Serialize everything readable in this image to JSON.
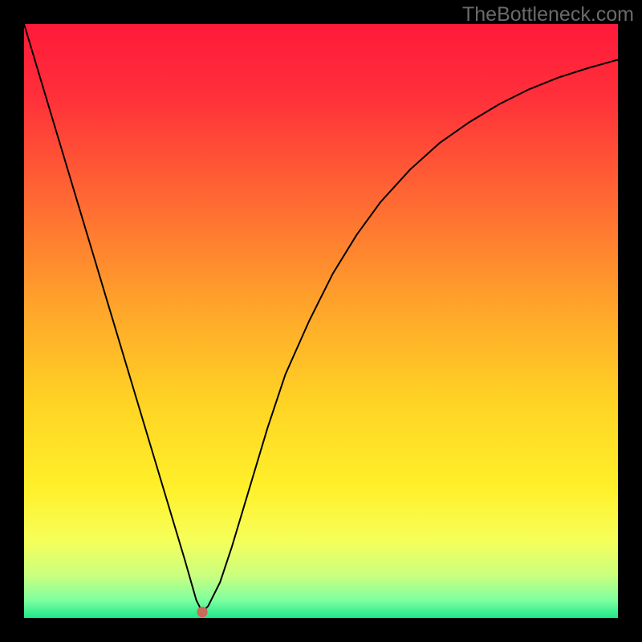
{
  "watermark": "TheBottleneck.com",
  "chart_data": {
    "type": "line",
    "title": "",
    "xlabel": "",
    "ylabel": "",
    "xlim": [
      0,
      100
    ],
    "ylim": [
      0,
      100
    ],
    "series": [
      {
        "name": "curve",
        "x": [
          0,
          3,
          6,
          9,
          12,
          15,
          18,
          21,
          24,
          27,
          29,
          30,
          31,
          33,
          35,
          38,
          41,
          44,
          48,
          52,
          56,
          60,
          65,
          70,
          75,
          80,
          85,
          90,
          95,
          100
        ],
        "y": [
          100,
          90,
          80,
          70,
          60,
          50,
          40,
          30,
          20,
          10,
          3,
          1,
          2,
          6,
          12,
          22,
          32,
          41,
          50,
          58,
          64.5,
          70,
          75.5,
          80,
          83.5,
          86.5,
          89,
          91,
          92.6,
          94
        ]
      }
    ],
    "marker": {
      "x": 30,
      "y": 1,
      "r": 0.9
    },
    "background": "rainbow-vertical",
    "annotations": []
  }
}
